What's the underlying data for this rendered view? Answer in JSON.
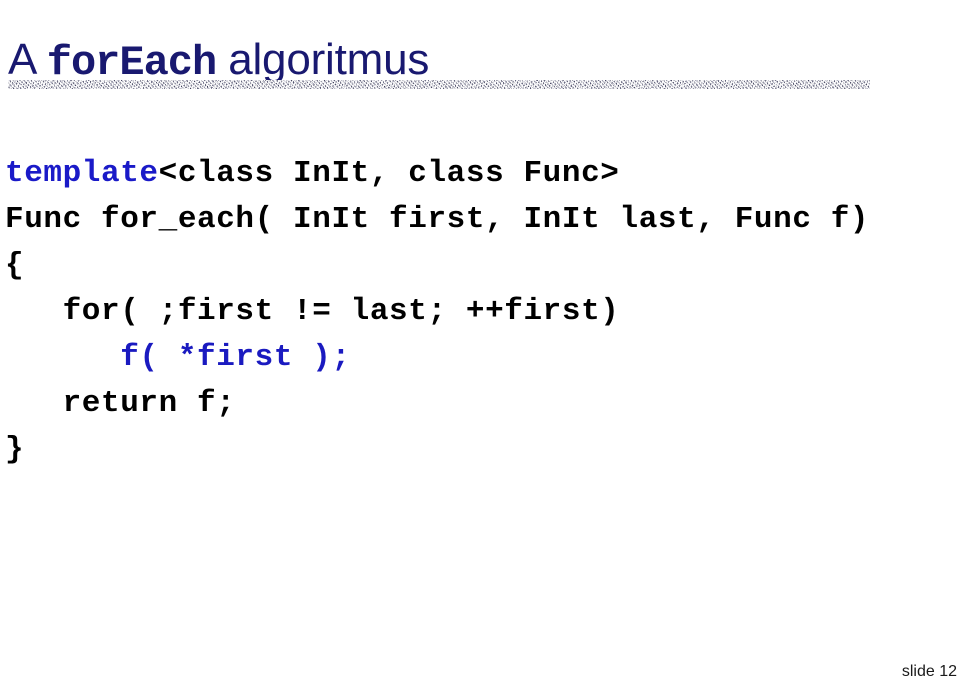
{
  "slide": {
    "title": {
      "prefix": "A ",
      "mono": "forEach",
      "suffix": " algoritmus",
      "full_text": "A forEach algoritmus",
      "color": "#191970"
    },
    "divider": {
      "name": "speckled-rule",
      "color": "#3c3c64"
    },
    "code": {
      "language": "C++",
      "lines": [
        {
          "indent": 0,
          "segments": [
            {
              "text": "template",
              "color": "#1a1ac8",
              "role": "keyword"
            },
            {
              "text": "<class InIt, class Func>",
              "color": "#000000",
              "role": "plain"
            }
          ],
          "plain_text": "template<class InIt, class Func>"
        },
        {
          "indent": 0,
          "segments": [
            {
              "text": "Func for_each( InIt first, InIt last, Func f)",
              "color": "#000000",
              "role": "plain"
            }
          ],
          "plain_text": "Func for_each( InIt first, InIt last, Func f)"
        },
        {
          "indent": 0,
          "segments": [
            {
              "text": "{",
              "color": "#000000",
              "role": "plain"
            }
          ],
          "plain_text": "{"
        },
        {
          "indent": 3,
          "segments": [
            {
              "text": "   for( ;first != last; ++first)",
              "color": "#000000",
              "role": "plain"
            }
          ],
          "plain_text": "   for( ;first != last; ++first)"
        },
        {
          "indent": 6,
          "segments": [
            {
              "text": "      f( *first );",
              "color": "#1a1ac0",
              "role": "highlight"
            }
          ],
          "plain_text": "      f( *first );"
        },
        {
          "indent": 3,
          "segments": [
            {
              "text": "   return f;",
              "color": "#000000",
              "role": "plain"
            }
          ],
          "plain_text": "   return f;"
        },
        {
          "indent": 0,
          "segments": [
            {
              "text": "}",
              "color": "#000000",
              "role": "plain"
            }
          ],
          "plain_text": "}"
        }
      ]
    },
    "footer": {
      "slide_label": "slide 12",
      "color": "#1a1a1a"
    }
  }
}
